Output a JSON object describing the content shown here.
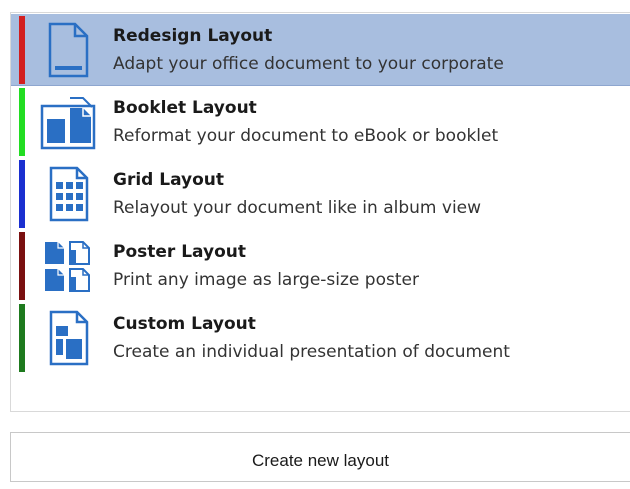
{
  "layouts": [
    {
      "title": "Redesign Layout",
      "description": "Adapt your office document to your corporate",
      "icon": "redesign-page-icon",
      "stripe_color": "#d21f1f",
      "selected": true
    },
    {
      "title": "Booklet Layout",
      "description": "Reformat your document to eBook or booklet",
      "icon": "booklet-icon",
      "stripe_color": "#22dd22",
      "selected": false
    },
    {
      "title": "Grid Layout",
      "description": "Relayout your document like in album view",
      "icon": "grid-icon",
      "stripe_color": "#1a2fd0",
      "selected": false
    },
    {
      "title": "Poster Layout",
      "description": "Print any image as large-size poster",
      "icon": "poster-icon",
      "stripe_color": "#7a1010",
      "selected": false
    },
    {
      "title": "Custom Layout",
      "description": "Create an individual presentation of document",
      "icon": "custom-layout-icon",
      "stripe_color": "#1e7a1e",
      "selected": false
    }
  ],
  "create_button": {
    "label": "Create new layout"
  },
  "colors": {
    "icon_blue": "#2a6fc4",
    "selection_background": "#a8bedf"
  }
}
